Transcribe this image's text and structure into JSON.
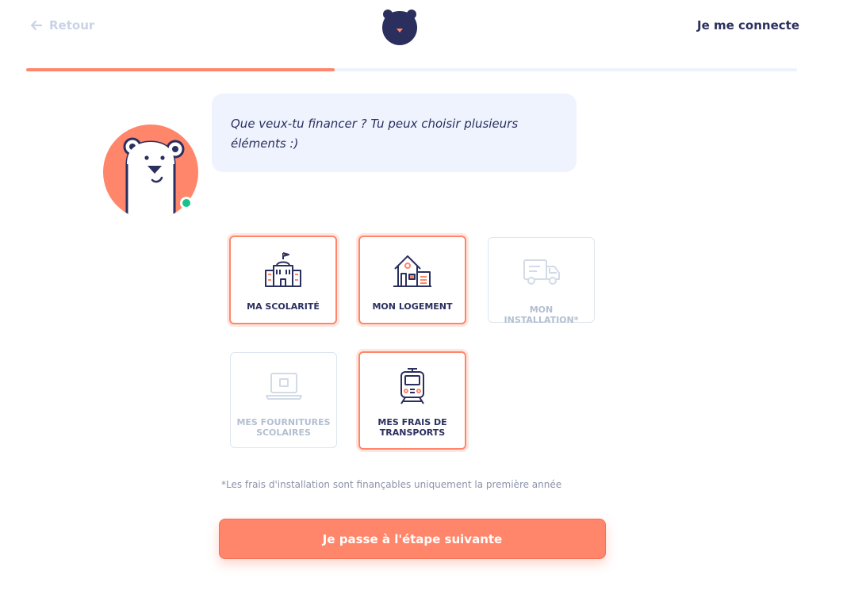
{
  "header": {
    "back_label": "Retour",
    "login_label": "Je me connecte"
  },
  "progress": {
    "fraction": 0.4
  },
  "chat": {
    "message": "Que veux-tu financer ? Tu peux choisir plusieurs éléments :)"
  },
  "options": [
    {
      "label": "MA SCOLARITÉ",
      "selected": true,
      "icon": "school-building-icon"
    },
    {
      "label": "MON LOGEMENT",
      "selected": true,
      "icon": "house-icon"
    },
    {
      "label": "MON INSTALLATION*",
      "selected": false,
      "icon": "moving-truck-icon"
    },
    {
      "label": "MES FOURNITURES SCOLAIRES",
      "selected": false,
      "icon": "laptop-icon"
    },
    {
      "label": "MES FRAIS DE TRANSPORTS",
      "selected": true,
      "icon": "train-icon"
    }
  ],
  "footnote": "*Les frais d'installation sont finançables uniquement la première année",
  "next_button_label": "Je passe à l'étape suivante",
  "colors": {
    "accent": "#ff866a",
    "navy": "#2b2f5e",
    "bubble": "#eef3fe",
    "online": "#16c48a",
    "disabled": "#b3bfd0"
  }
}
